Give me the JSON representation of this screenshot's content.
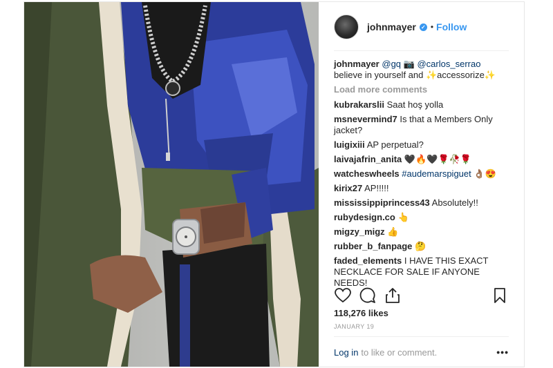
{
  "header": {
    "username": "johnmayer",
    "verified_glyph": "✓",
    "separator": "•",
    "follow_label": "Follow"
  },
  "caption": {
    "username": "johnmayer",
    "mention1": "@gq",
    "emoji": "📷",
    "mention2": "@carlos_serrao",
    "text": "believe in yourself and ✨accessorize✨"
  },
  "load_more": "Load more comments",
  "comments": [
    {
      "user": "kubrakarslii",
      "text": "Saat hoş yolla"
    },
    {
      "user": "msnevermind7",
      "text": "Is that a Members Only jacket?"
    },
    {
      "user": "luigixiii",
      "text": "AP perpetual?"
    },
    {
      "user": "laivajafrin_anita",
      "text": "🖤🔥🖤🌹🥀🌹"
    },
    {
      "user": "watcheswheels",
      "tag": "#audemarspiguet",
      "text": "👌🏽😍"
    },
    {
      "user": "kirix27",
      "text": "AP!!!!!"
    },
    {
      "user": "mississippiprincess43",
      "text": "Absolutely!!"
    },
    {
      "user": "rubydesign.co",
      "text": "👆"
    },
    {
      "user": "migzy_migz",
      "text": "👍"
    },
    {
      "user": "rubber_b_fanpage",
      "text": "🤔"
    },
    {
      "user": "faded_elements",
      "text": "I HAVE THIS EXACT NECKLACE FOR SALE IF ANYONE NEEDS!"
    }
  ],
  "icons": {
    "like": "heart-icon",
    "comment": "comment-icon",
    "share": "share-icon",
    "save": "bookmark-icon",
    "more": "more-options-icon"
  },
  "likes": "118,276 likes",
  "date": "JANUARY 19",
  "footer": {
    "login_label": "Log in",
    "prompt": "to like or comment.",
    "more_glyph": "•••"
  },
  "colors": {
    "link": "#3897f0",
    "dark_link": "#003569",
    "muted": "#999999",
    "text": "#262626",
    "border": "#efefef"
  }
}
